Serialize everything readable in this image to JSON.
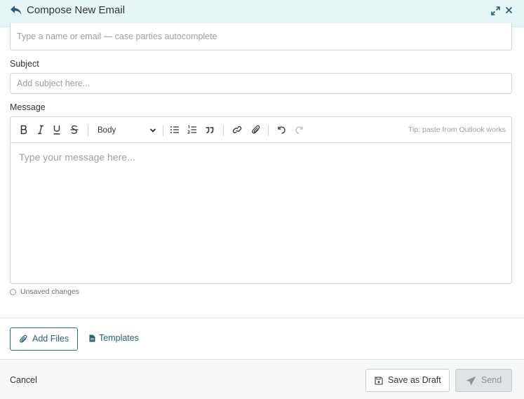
{
  "header": {
    "title": "Compose New Email",
    "accent": "#2f5f73",
    "background": "#e6f6f6"
  },
  "to": {
    "placeholder": "Type a name or email — case parties autocomplete"
  },
  "subject": {
    "label": "Subject",
    "placeholder": "Add subject here..."
  },
  "message": {
    "label": "Message",
    "placeholder": "Type your message here...",
    "toolbar": {
      "format_selected": "Body",
      "tip": "Tip: paste from Outlook works"
    }
  },
  "status": {
    "unsaved": "Unsaved changes"
  },
  "attachments": {
    "add_files": "Add Files",
    "templates": "Templates"
  },
  "footer": {
    "cancel": "Cancel",
    "save_draft": "Save as Draft",
    "send": "Send"
  },
  "icons": [
    "reply-icon",
    "expand-icon",
    "close-icon",
    "bold-icon",
    "italic-icon",
    "underline-icon",
    "strikethrough-icon",
    "chevron-down-icon",
    "bullet-list-icon",
    "numbered-list-icon",
    "quote-icon",
    "link-icon",
    "attachment-icon",
    "undo-icon",
    "redo-icon",
    "paperclip-icon",
    "document-icon",
    "save-icon",
    "send-icon"
  ]
}
